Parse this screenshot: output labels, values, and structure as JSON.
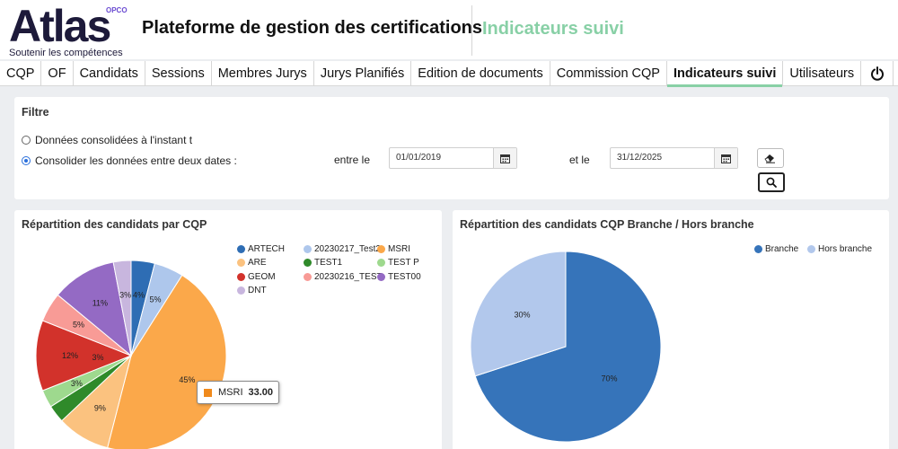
{
  "header": {
    "logo_word": "Atlas",
    "logo_opco": "OPCO",
    "logo_tagline": "Soutenir les compétences",
    "app_title": "Plateforme de gestion des certifications",
    "section_title": "Indicateurs suivi"
  },
  "nav": {
    "tabs": [
      {
        "label": "CQP"
      },
      {
        "label": "OF"
      },
      {
        "label": "Candidats"
      },
      {
        "label": "Sessions"
      },
      {
        "label": "Membres Jurys"
      },
      {
        "label": "Jurys Planifiés"
      },
      {
        "label": "Edition de documents"
      },
      {
        "label": "Commission CQP"
      },
      {
        "label": "Indicateurs suivi",
        "active": true
      },
      {
        "label": "Utilisateurs"
      }
    ],
    "power_icon": "power-icon"
  },
  "filter": {
    "title": "Filtre",
    "option_instant": "Données consolidées à l'instant t",
    "option_range": "Consolider les données entre deux dates :",
    "selected_option": "option_range",
    "between_label": "entre le",
    "start_date": "01/01/2019",
    "and_label": "et le",
    "end_date": "31/12/2025",
    "clear_icon": "eraser-icon",
    "search_icon": "search-icon",
    "calendar_icon": "calendar-icon"
  },
  "chart_data": [
    {
      "type": "pie",
      "title": "Répartition des candidats par CQP",
      "legend_position": "top-right",
      "series": [
        {
          "name": "ARTECH",
          "value": 4,
          "label": "4%",
          "color": "#2e6db4"
        },
        {
          "name": "20230217_Test2",
          "value": 5,
          "label": "5%",
          "color": "#aec7ec"
        },
        {
          "name": "MSRI",
          "value": 45,
          "label": "45%",
          "color": "#fba84a"
        },
        {
          "name": "ARE",
          "value": 9,
          "label": "9%",
          "color": "#fbc27f"
        },
        {
          "name": "TEST1",
          "value": 3,
          "label": "",
          "color": "#2f8a2a"
        },
        {
          "name": "TEST P",
          "value": 3,
          "label": "3%",
          "color": "#9ed98e"
        },
        {
          "name": "GEOM",
          "value": 12,
          "label": "12%",
          "color": "#d2322b"
        },
        {
          "name": "20230216_TEST",
          "value": 5,
          "label": "5%",
          "color": "#f89b96"
        },
        {
          "name": "TEST00",
          "value": 11,
          "label": "11%",
          "color": "#946ac4"
        },
        {
          "name": "DNT",
          "value": 3,
          "label": "3%",
          "color": "#c8b6de"
        }
      ],
      "extra_labels": [
        "3%"
      ],
      "tooltip": {
        "name": "MSRI",
        "value": "33.00",
        "color": "#f08a1c"
      }
    },
    {
      "type": "pie",
      "title": "Répartition des candidats CQP Branche / Hors branche",
      "legend_position": "top-right",
      "series": [
        {
          "name": "Branche",
          "value": 70,
          "label": "70%",
          "color": "#3674ba"
        },
        {
          "name": "Hors branche",
          "value": 30,
          "label": "30%",
          "color": "#b2c8ec"
        }
      ]
    }
  ]
}
